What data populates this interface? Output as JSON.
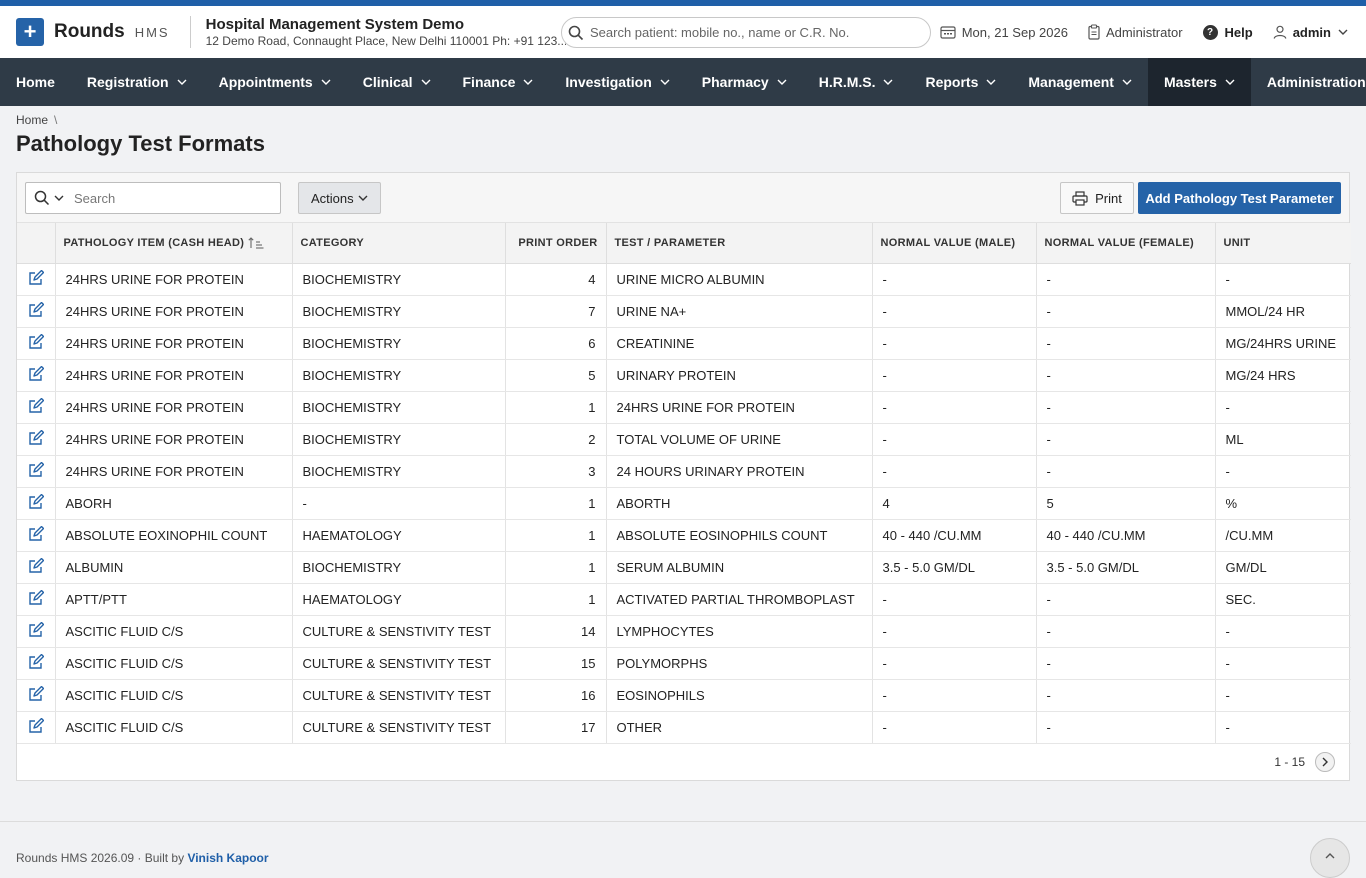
{
  "app": {
    "logo_name": "Rounds",
    "logo_sub": "HMS",
    "hospital_name": "Hospital Management System Demo",
    "hospital_address": "12 Demo Road, Connaught Place, New Delhi 110001 Ph: +91 123..."
  },
  "header": {
    "search_placeholder": "Search patient: mobile no., name or C.R. No.",
    "date": "Mon, 21 Sep 2026",
    "role": "Administrator",
    "help": "Help",
    "user": "admin"
  },
  "nav": [
    {
      "label": "Home",
      "has_menu": false,
      "active": false
    },
    {
      "label": "Registration",
      "has_menu": true,
      "active": false
    },
    {
      "label": "Appointments",
      "has_menu": true,
      "active": false
    },
    {
      "label": "Clinical",
      "has_menu": true,
      "active": false
    },
    {
      "label": "Finance",
      "has_menu": true,
      "active": false
    },
    {
      "label": "Investigation",
      "has_menu": true,
      "active": false
    },
    {
      "label": "Pharmacy",
      "has_menu": true,
      "active": false
    },
    {
      "label": "H.R.M.S.",
      "has_menu": true,
      "active": false
    },
    {
      "label": "Reports",
      "has_menu": true,
      "active": false
    },
    {
      "label": "Management",
      "has_menu": true,
      "active": false
    },
    {
      "label": "Masters",
      "has_menu": true,
      "active": true
    },
    {
      "label": "Administration",
      "has_menu": true,
      "active": false
    }
  ],
  "breadcrumb": {
    "home": "Home",
    "separator": "\\"
  },
  "page": {
    "title": "Pathology Test Formats"
  },
  "toolbar": {
    "search_placeholder": "Search",
    "actions_label": "Actions",
    "print_label": "Print",
    "add_label": "Add Pathology Test Parameter"
  },
  "table": {
    "columns": [
      "PATHOLOGY ITEM (CASH HEAD)",
      "CATEGORY",
      "PRINT ORDER",
      "TEST / PARAMETER",
      "NORMAL VALUE (MALE)",
      "NORMAL VALUE (FEMALE)",
      "UNIT"
    ],
    "rows": [
      [
        "24HRS URINE FOR PROTEIN",
        "BIOCHEMISTRY",
        "4",
        "URINE MICRO ALBUMIN",
        "-",
        "-",
        "-"
      ],
      [
        "24HRS URINE FOR PROTEIN",
        "BIOCHEMISTRY",
        "7",
        "URINE NA+",
        "-",
        "-",
        "MMOL/24 HR"
      ],
      [
        "24HRS URINE FOR PROTEIN",
        "BIOCHEMISTRY",
        "6",
        "CREATININE",
        "-",
        "-",
        "MG/24HRS URINE"
      ],
      [
        "24HRS URINE FOR PROTEIN",
        "BIOCHEMISTRY",
        "5",
        "URINARY PROTEIN",
        "-",
        "-",
        "MG/24 HRS"
      ],
      [
        "24HRS URINE FOR PROTEIN",
        "BIOCHEMISTRY",
        "1",
        "24HRS URINE FOR PROTEIN",
        "-",
        "-",
        "-"
      ],
      [
        "24HRS URINE FOR PROTEIN",
        "BIOCHEMISTRY",
        "2",
        "TOTAL VOLUME OF URINE",
        "-",
        "-",
        "ML"
      ],
      [
        "24HRS URINE FOR PROTEIN",
        "BIOCHEMISTRY",
        "3",
        "24 HOURS URINARY PROTEIN",
        "-",
        "-",
        "-"
      ],
      [
        "ABORH",
        "-",
        "1",
        "ABORTH",
        "4",
        "5",
        "%"
      ],
      [
        "ABSOLUTE EOXINOPHIL COUNT",
        "HAEMATOLOGY",
        "1",
        "ABSOLUTE EOSINOPHILS COUNT",
        "40 - 440 /CU.MM",
        "40 - 440 /CU.MM",
        "/CU.MM"
      ],
      [
        "ALBUMIN",
        "BIOCHEMISTRY",
        "1",
        "SERUM ALBUMIN",
        "3.5 - 5.0 GM/DL",
        "3.5 - 5.0 GM/DL",
        "GM/DL"
      ],
      [
        "APTT/PTT",
        "HAEMATOLOGY",
        "1",
        "ACTIVATED PARTIAL THROMBOPLAST",
        "-",
        "-",
        "SEC."
      ],
      [
        "ASCITIC FLUID C/S",
        "CULTURE & SENSTIVITY TEST",
        "14",
        "LYMPHOCYTES",
        "-",
        "-",
        "-"
      ],
      [
        "ASCITIC FLUID C/S",
        "CULTURE & SENSTIVITY TEST",
        "15",
        "POLYMORPHS",
        "-",
        "-",
        "-"
      ],
      [
        "ASCITIC FLUID C/S",
        "CULTURE & SENSTIVITY TEST",
        "16",
        "EOSINOPHILS",
        "-",
        "-",
        "-"
      ],
      [
        "ASCITIC FLUID C/S",
        "CULTURE & SENSTIVITY TEST",
        "17",
        "OTHER",
        "-",
        "-",
        "-"
      ]
    ]
  },
  "pagination": {
    "range": "1 - 15"
  },
  "footer": {
    "text": "Rounds HMS 2026.09 · Built by",
    "author": "Vinish Kapoor"
  }
}
